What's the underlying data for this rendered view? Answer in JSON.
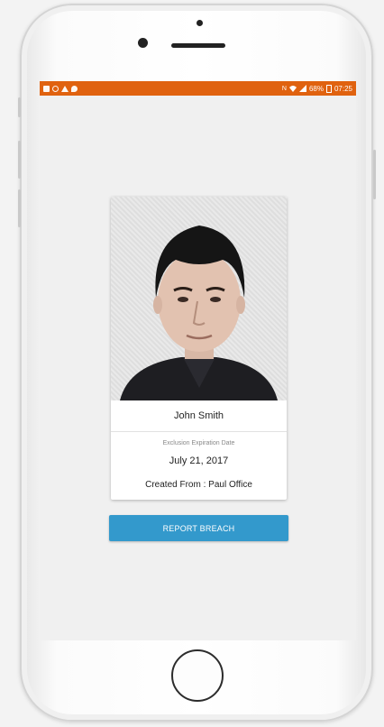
{
  "status_bar": {
    "left_icons": [
      "notification-icon",
      "circle-icon",
      "warning-icon",
      "chat-icon"
    ],
    "right_icons": [
      "nfc-icon",
      "wifi-icon",
      "signal-icon"
    ],
    "battery": "68%",
    "time": "07:25",
    "color": "#e0620f"
  },
  "person": {
    "name": "John Smith"
  },
  "exclusion": {
    "label": "Exclusion Expiration Date",
    "date": "July 21, 2017",
    "created_from": "Created From : Paul Office"
  },
  "actions": {
    "report_label": "REPORT BREACH",
    "report_color": "#3399cc"
  }
}
